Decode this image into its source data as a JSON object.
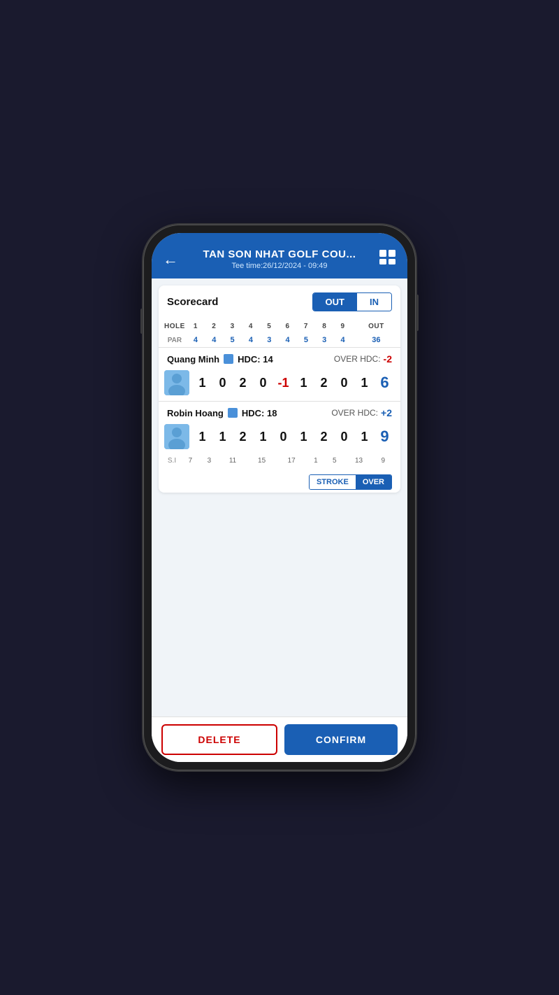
{
  "phone": {
    "header": {
      "back_icon": "←",
      "title": "TAN SON NHAT GOLF COU...",
      "tee_time": "Tee time:26/12/2024 - 09:49",
      "layout_icon": "⊞"
    },
    "scorecard": {
      "label": "Scorecard",
      "tab_out": "OUT",
      "tab_in": "IN",
      "holes": [
        "HOLE",
        "1",
        "2",
        "3",
        "4",
        "5",
        "6",
        "7",
        "8",
        "9",
        "OUT"
      ],
      "par_label": "PAR",
      "par_values": [
        "4",
        "4",
        "5",
        "4",
        "3",
        "4",
        "5",
        "3",
        "4",
        "36"
      ],
      "players": [
        {
          "name": "Quang Minh",
          "color": "#4a90d9",
          "hdc_label": "HDC:",
          "hdc": "14",
          "over_hdc_label": "OVER HDC:",
          "over_hdc": "-2",
          "over_hdc_sign": "negative",
          "scores": [
            "1",
            "0",
            "2",
            "0",
            "-1",
            "1",
            "2",
            "0",
            "1"
          ],
          "score_colors": [
            "black",
            "black",
            "black",
            "black",
            "red",
            "black",
            "black",
            "black",
            "black"
          ],
          "total": "6",
          "total_color": "blue"
        },
        {
          "name": "Robin Hoang",
          "color": "#4a90d9",
          "hdc_label": "HDC:",
          "hdc": "18",
          "over_hdc_label": "OVER HDC:",
          "over_hdc": "+2",
          "over_hdc_sign": "positive",
          "scores": [
            "1",
            "1",
            "2",
            "1",
            "0",
            "1",
            "2",
            "0",
            "1"
          ],
          "score_colors": [
            "black",
            "black",
            "black",
            "black",
            "black",
            "black",
            "black",
            "black",
            "black"
          ],
          "total": "9",
          "total_color": "blue"
        }
      ],
      "si_label": "S.I",
      "si_values": [
        "7",
        "3",
        "11",
        "15",
        "17",
        "1",
        "5",
        "13",
        "9"
      ],
      "toggle": {
        "stroke": "STROKE",
        "over": "OVER"
      }
    },
    "buttons": {
      "delete": "DELETE",
      "confirm": "CONFIRM"
    }
  }
}
